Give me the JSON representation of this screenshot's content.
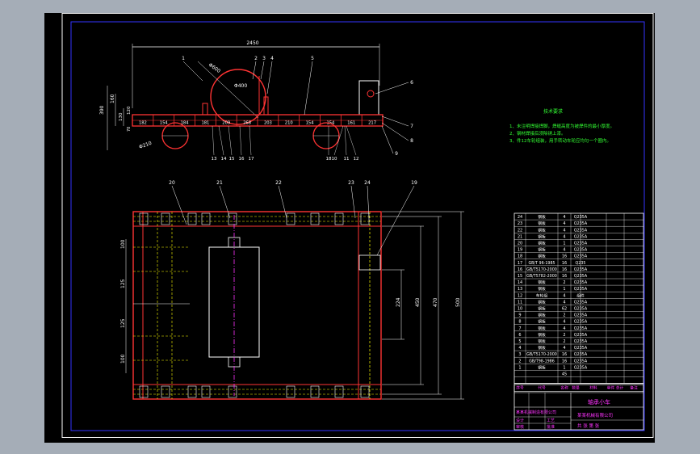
{
  "drawing": {
    "dimensions": {
      "overall_length": "2450",
      "roller_dia_large": "Φ600",
      "roller_dia_inner": "Φ400",
      "wheel_dia": "Φ210",
      "height_total": "390",
      "height_a": "160",
      "height_b": "130",
      "height_c": "120",
      "height_d": "70",
      "width_500": "500",
      "width_470": "470",
      "width_450": "450",
      "width_224": "224",
      "left_dims": [
        "100",
        "125",
        "125",
        "100"
      ]
    },
    "segments": [
      "182",
      "154",
      "184",
      "181",
      "209",
      "268",
      "203",
      "210",
      "154",
      "154",
      "161",
      "217"
    ],
    "callouts_top": [
      "1",
      "2",
      "3",
      "4",
      "5"
    ],
    "callouts_right": [
      "6",
      "7",
      "8",
      "9"
    ],
    "callouts_bottom": [
      "10",
      "11",
      "12",
      "13",
      "14",
      "15",
      "16",
      "17",
      "18"
    ],
    "callouts_plan": [
      "20",
      "21",
      "22",
      "23",
      "24",
      "19"
    ],
    "tech_title": "技术要求",
    "tech_notes": [
      "1、未注明焊接焊脚，焊缝高度为被焊件的最小厚度。",
      "2、钢材焊接后须除锈上漆。",
      "3、件12车轮组装，用手转动车轮应均匀一个圈内。"
    ],
    "bom_rows": [
      {
        "no": "24",
        "name": "钢板",
        "qty": "4",
        "mat": "Q235A"
      },
      {
        "no": "23",
        "name": "钢板",
        "qty": "4",
        "mat": "Q235A"
      },
      {
        "no": "22",
        "name": "钢板",
        "qty": "4",
        "mat": "Q235A"
      },
      {
        "no": "21",
        "name": "钢板",
        "qty": "4",
        "mat": "Q235A"
      },
      {
        "no": "20",
        "name": "钢板",
        "qty": "1",
        "mat": "Q235A"
      },
      {
        "no": "19",
        "name": "钢板",
        "qty": "4",
        "mat": "Q235A"
      },
      {
        "no": "18",
        "name": "钢板",
        "qty": "16",
        "mat": "Q235A"
      },
      {
        "no": "17",
        "name": "GB/T 96-1985",
        "qty": "16",
        "mat": "Q235"
      },
      {
        "no": "16",
        "name": "GB/T5170-2000",
        "qty": "16",
        "mat": "Q235A"
      },
      {
        "no": "15",
        "name": "GB/T5782-2000",
        "qty": "16",
        "mat": "Q235A"
      },
      {
        "no": "14",
        "name": "钢板",
        "qty": "2",
        "mat": "Q235A"
      },
      {
        "no": "13",
        "name": "钢板",
        "qty": "1",
        "mat": "Q235A"
      },
      {
        "no": "12",
        "name": "车轮组",
        "qty": "4",
        "mat": "组件"
      },
      {
        "no": "11",
        "name": "钢板",
        "qty": "4",
        "mat": "Q235A"
      },
      {
        "no": "10",
        "name": "钢板",
        "qty": "62",
        "mat": "Q235A"
      },
      {
        "no": "9",
        "name": "钢板",
        "qty": "2",
        "mat": "Q235A"
      },
      {
        "no": "8",
        "name": "钢板",
        "qty": "4",
        "mat": "Q235A"
      },
      {
        "no": "7",
        "name": "钢板",
        "qty": "4",
        "mat": "Q235A"
      },
      {
        "no": "6",
        "name": "钢板",
        "qty": "2",
        "mat": "Q235A"
      },
      {
        "no": "5",
        "name": "钢板",
        "qty": "2",
        "mat": "Q235A"
      },
      {
        "no": "4",
        "name": "钢板",
        "qty": "4",
        "mat": "Q235A"
      },
      {
        "no": "3",
        "name": "GB/T5170-2000",
        "qty": "16",
        "mat": "Q235A"
      },
      {
        "no": "2",
        "name": "GB/T98-1986",
        "qty": "16",
        "mat": "Q235A"
      },
      {
        "no": "1",
        "name": "钢板",
        "qty": "1",
        "mat": "Q235A"
      }
    ],
    "bom_extra": "45",
    "bom_header": [
      "序号",
      "代号",
      "名称",
      "数量",
      "材料",
      "单件 总计",
      "备注"
    ],
    "title_block": {
      "product": "轴承小车",
      "org": "某某机械制造有限公司",
      "company": "某某机械有限公司",
      "sign1": "设计",
      "sign2": "审核",
      "sign3": "工艺",
      "sign4": "批准",
      "scale_label": "共 张 第 张"
    }
  }
}
